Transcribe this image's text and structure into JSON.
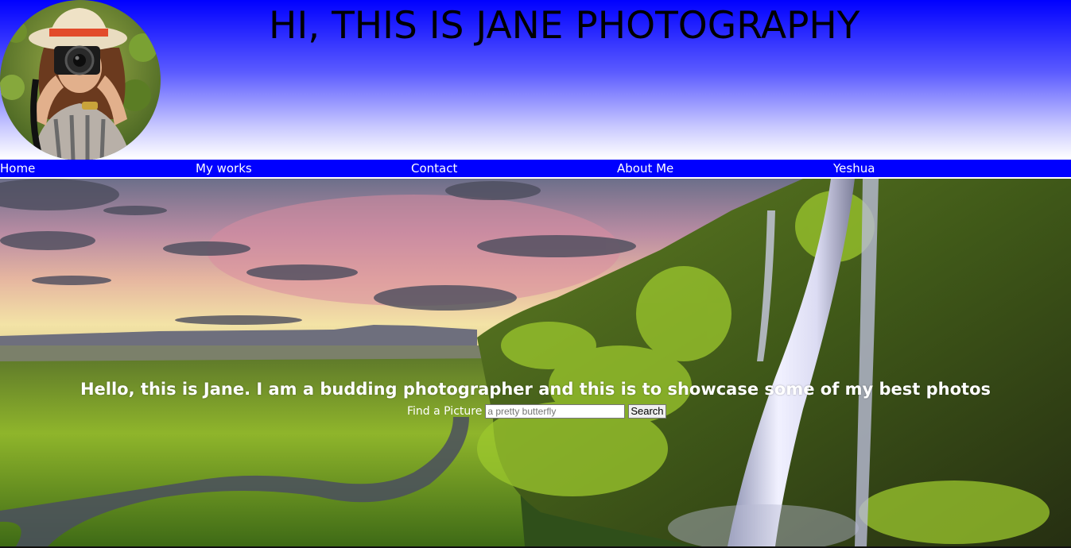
{
  "header": {
    "title": "HI, THIS IS JANE PHOTOGRAPHY",
    "avatar_icon": "photographer-portrait"
  },
  "nav": {
    "items": [
      {
        "label": "Home"
      },
      {
        "label": "My works"
      },
      {
        "label": "Contact"
      },
      {
        "label": "About Me"
      },
      {
        "label": "Yeshua"
      }
    ]
  },
  "hero": {
    "heading": "Hello, this is Jane. I am a budding photographer and this is to showcase some of my best photos",
    "search_label": "Find a Picture",
    "search_placeholder": "a pretty butterfly",
    "search_button": "Search"
  },
  "colors": {
    "header_top": "#0000ff",
    "nav_background": "#0000ff",
    "text_light": "#ffffff"
  }
}
